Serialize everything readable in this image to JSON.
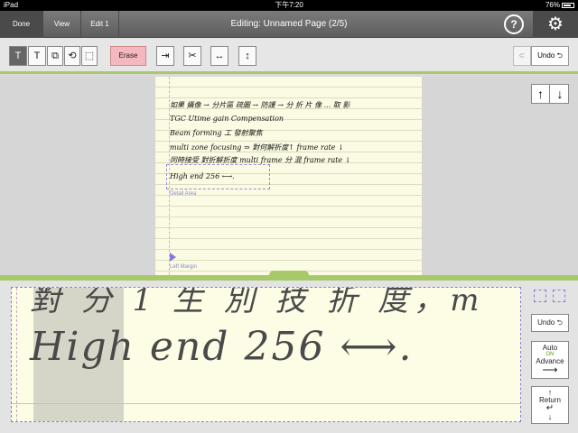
{
  "status": {
    "device": "iPad",
    "time": "下午7:20",
    "battery": "76%"
  },
  "nav": {
    "tabs": [
      "Done",
      "View",
      "Edit 1"
    ],
    "title": "Editing: Unnamed Page (2/5)",
    "help": "?",
    "gear": "⚙"
  },
  "toolbar": {
    "erase": "Erase",
    "undo": "Undo",
    "undo_symbol": "⮌",
    "redo_symbol": "⊂"
  },
  "page": {
    "lines": [
      "如果 攝像 → 分片區 疏圖 → 防護 → 分 折 片 像 ... 取 影",
      "TGC Utime gain Compensation",
      "Beam forming 工 發射聚焦",
      "multi zone focusing ⇒ 對何解折度↑ frame rate ↓",
      "同時接受 對折解折度 multi frame 分 混 frame rate ↓",
      "High end 256 ⟷."
    ],
    "detail_label": "Detail Area",
    "margin_label": "Left Margin"
  },
  "pad": {
    "text_top": "對 分 1 生 別 技 折 度，m",
    "text_main": "High end 256 ⟷."
  },
  "side": {
    "undo": "Undo",
    "auto": "Auto",
    "on": "ON",
    "advance": "Advance",
    "return": "Return",
    "up": "↑",
    "down": "↓"
  }
}
